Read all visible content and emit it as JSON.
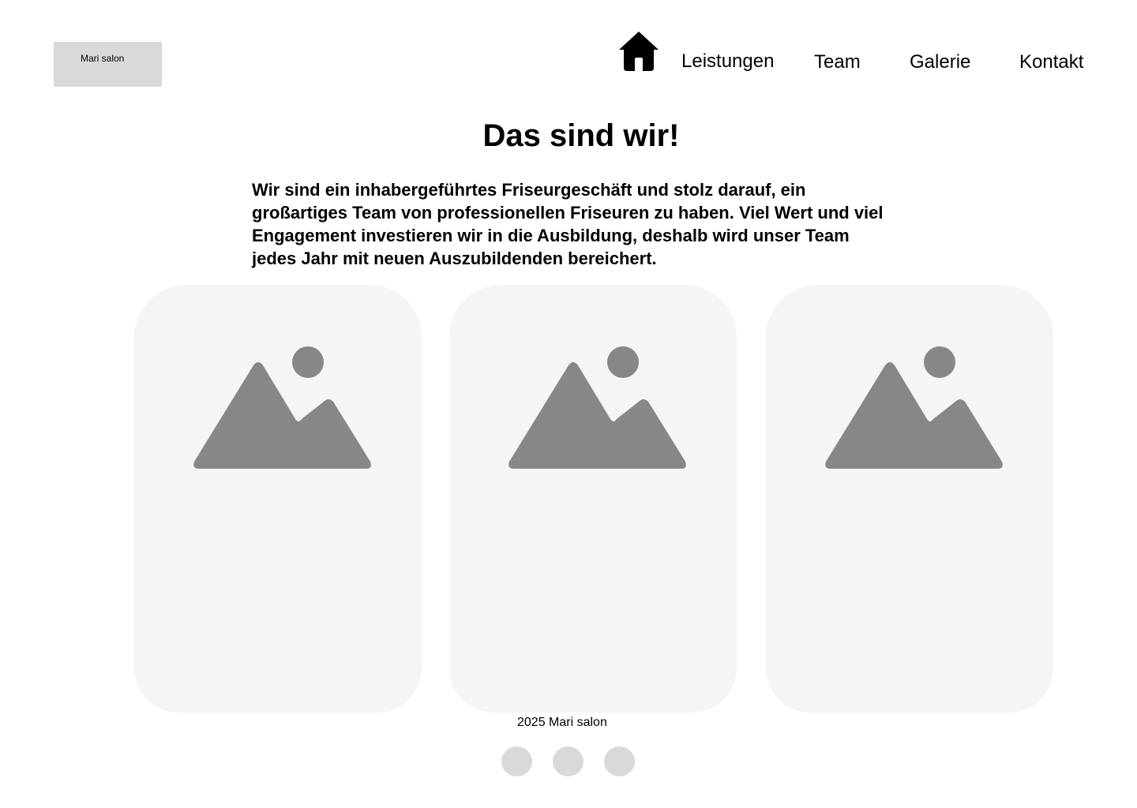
{
  "header": {
    "logo_text": "Mari salon",
    "home_icon": "home-icon",
    "nav": [
      {
        "label": "Leistungen"
      },
      {
        "label": "Team"
      },
      {
        "label": "Galerie"
      },
      {
        "label": "Kontakt"
      }
    ]
  },
  "main": {
    "title": "Das sind wir!",
    "intro": "Wir sind ein inhabergeführtes Friseurgeschäft und stolz darauf, ein großartiges Team von professionellen Friseuren zu haben. Viel Wert und viel Engagement investieren wir in die Ausbildung, deshalb wird unser Team jedes Jahr mit neuen Auszubildenden bereichert.",
    "cards": [
      {
        "image_icon": "image-placeholder-icon"
      },
      {
        "image_icon": "image-placeholder-icon"
      },
      {
        "image_icon": "image-placeholder-icon"
      }
    ]
  },
  "footer": {
    "text": "2025 Mari salon",
    "pagination_count": 3
  },
  "colors": {
    "logo_bg": "#d9d9d9",
    "card_bg": "#f5f5f5",
    "image_icon": "#878787",
    "dot": "#d9d9d9",
    "text": "#000000"
  }
}
